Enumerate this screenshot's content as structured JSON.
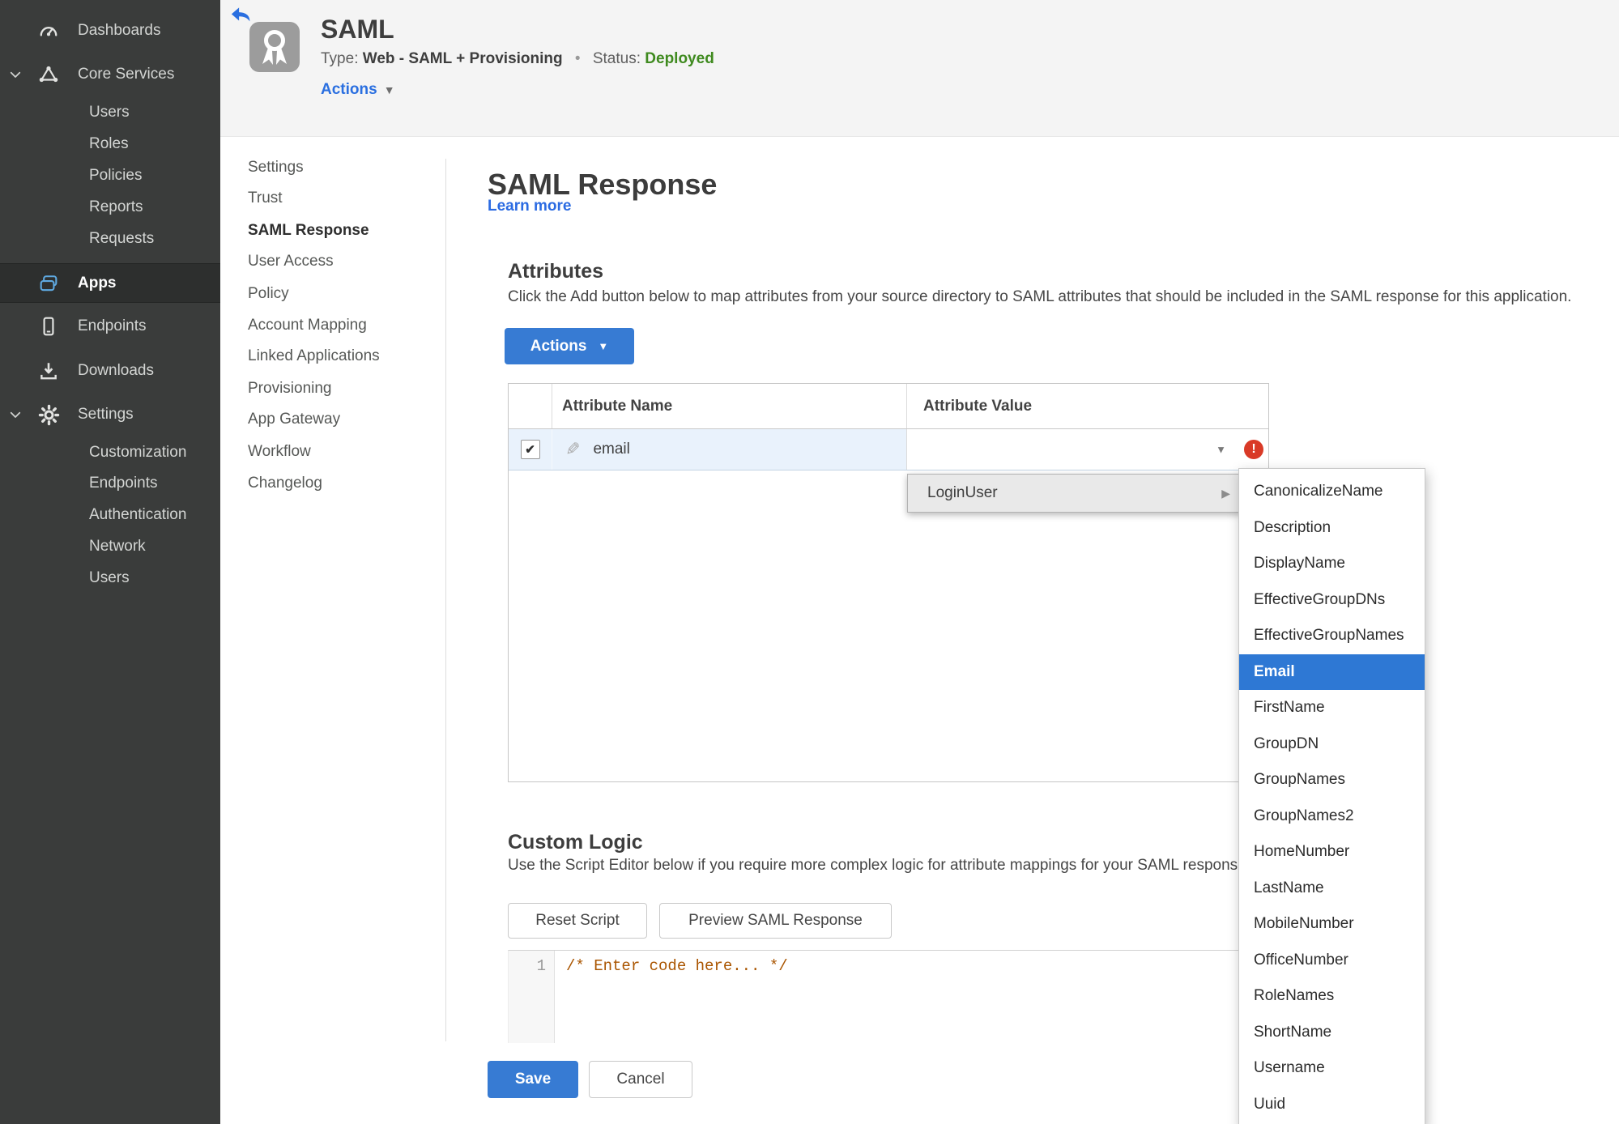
{
  "sidebar": {
    "items": [
      {
        "label": "Dashboards",
        "icon": "gauge-icon"
      },
      {
        "label": "Core Services",
        "icon": "core-services-icon",
        "expanded": true
      },
      {
        "label": "Users"
      },
      {
        "label": "Roles"
      },
      {
        "label": "Policies"
      },
      {
        "label": "Reports"
      },
      {
        "label": "Requests"
      },
      {
        "label": "Apps",
        "icon": "apps-icon",
        "active": true
      },
      {
        "label": "Endpoints",
        "icon": "mobile-device-icon"
      },
      {
        "label": "Downloads",
        "icon": "download-icon"
      },
      {
        "label": "Settings",
        "icon": "gear-icon",
        "expanded": true
      },
      {
        "label": "Customization"
      },
      {
        "label": "Endpoints"
      },
      {
        "label": "Authentication"
      },
      {
        "label": "Network"
      },
      {
        "label": "Users"
      }
    ]
  },
  "header": {
    "back_icon": "back-arrow-icon",
    "app_icon": "certificate-ribbon-icon",
    "title": "SAML",
    "type_label": "Type:",
    "type_value": "Web - SAML + Provisioning",
    "separator": "•",
    "status_label": "Status:",
    "status_value": "Deployed",
    "actions_label": "Actions"
  },
  "app_nav": {
    "items": [
      {
        "label": "Settings"
      },
      {
        "label": "Trust"
      },
      {
        "label": "SAML Response",
        "active": true
      },
      {
        "label": "User Access"
      },
      {
        "label": "Policy"
      },
      {
        "label": "Account Mapping"
      },
      {
        "label": "Linked Applications"
      },
      {
        "label": "Provisioning"
      },
      {
        "label": "App Gateway"
      },
      {
        "label": "Workflow"
      },
      {
        "label": "Changelog"
      }
    ]
  },
  "main": {
    "title": "SAML Response",
    "learn_more": "Learn more",
    "attributes": {
      "heading": "Attributes",
      "description": "Click the Add button below to map attributes from your source directory to SAML attributes that should be included in the SAML response for this application.",
      "actions_button": "Actions",
      "table": {
        "columns": [
          "Attribute Name",
          "Attribute Value"
        ],
        "row": {
          "name": "email",
          "checked": true,
          "value": ""
        }
      }
    },
    "value_menu": {
      "parent": "LoginUser",
      "selected": "Email",
      "options": [
        "CanonicalizeName",
        "Description",
        "DisplayName",
        "EffectiveGroupDNs",
        "EffectiveGroupNames",
        "Email",
        "FirstName",
        "GroupDN",
        "GroupNames",
        "GroupNames2",
        "HomeNumber",
        "LastName",
        "MobileNumber",
        "OfficeNumber",
        "RoleNames",
        "ShortName",
        "Username",
        "Uuid"
      ]
    },
    "custom_logic": {
      "heading": "Custom Logic",
      "description": "Use the Script Editor below if you require more complex logic for attribute mappings for your SAML response.",
      "reset_button": "Reset Script",
      "preview_button": "Preview SAML Response",
      "editor": {
        "line_number": "1",
        "code": "/* Enter code here... */"
      }
    },
    "footer": {
      "save": "Save",
      "cancel": "Cancel"
    }
  },
  "colors": {
    "accent_blue": "#377bd3",
    "link_blue": "#2b6be2",
    "selected_blue": "#2e78d4",
    "status_green": "#3f8a1f",
    "error_red": "#d93a27",
    "row_highlight": "#e9f2fc",
    "sidebar_bg": "#3a3c3b",
    "sidebar_active_bg": "#2d2f2e"
  }
}
